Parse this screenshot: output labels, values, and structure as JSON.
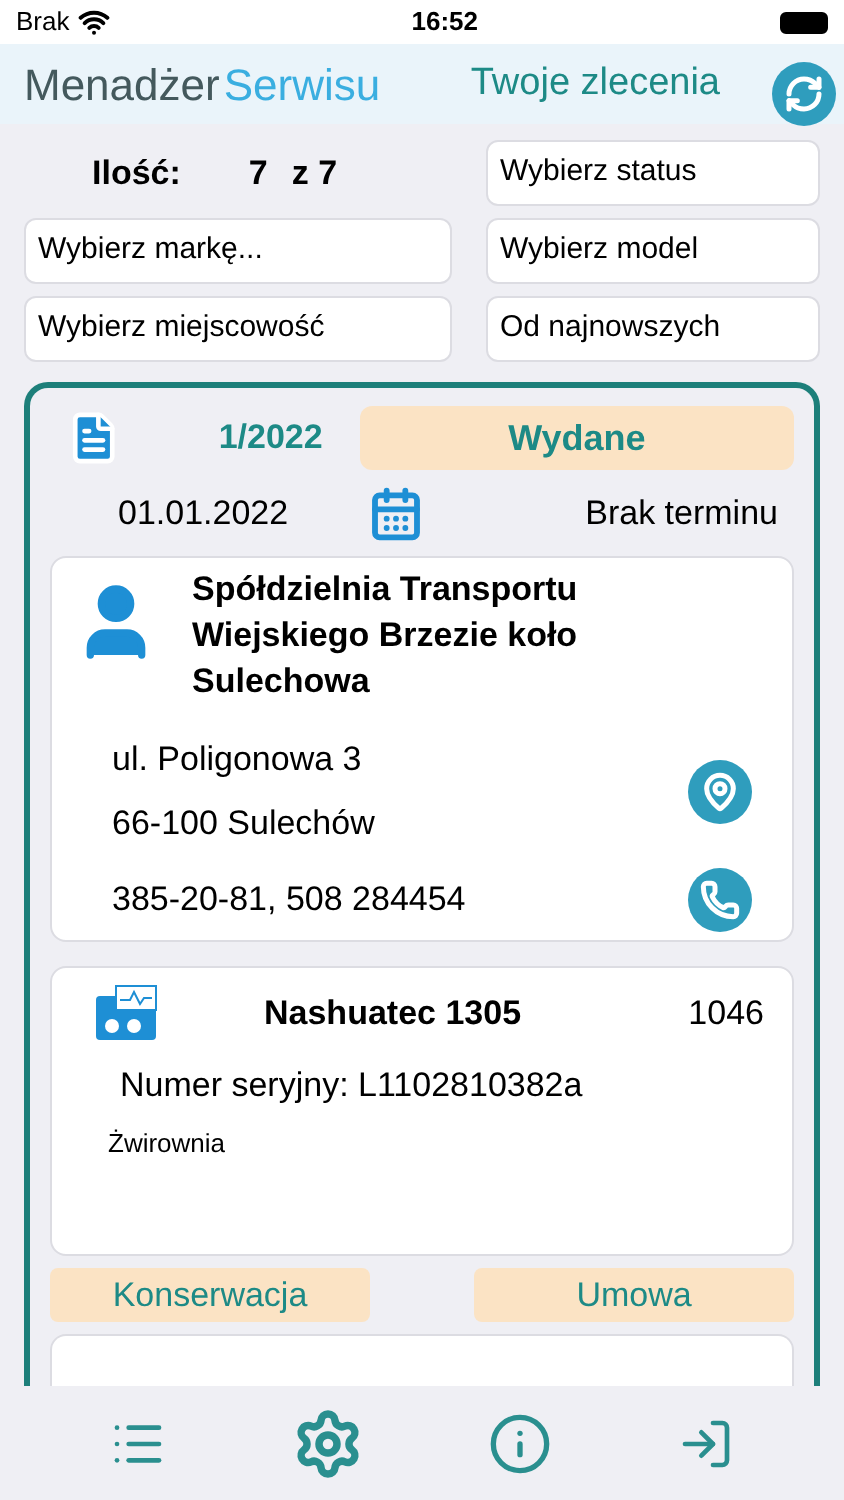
{
  "status_bar": {
    "carrier": "Brak",
    "time": "16:52"
  },
  "header": {
    "logo_part1": "Menadżer",
    "logo_part2": "Serwisu",
    "title": "Twoje zlecenia"
  },
  "filters": {
    "count_label": "Ilość:",
    "count": "7",
    "count_total": "z 7",
    "fields": [
      {
        "value": "Wybierz status"
      },
      {
        "value": "Wybierz markę..."
      },
      {
        "value": "Wybierz model"
      },
      {
        "value": "Wybierz miejscowość"
      },
      {
        "value": "Od najnowszych"
      }
    ]
  },
  "order": {
    "number": "1/2022",
    "status": "Wydane",
    "date": "01.01.2022",
    "deadline": "Brak terminu",
    "client": {
      "name": "Spółdzielnia Transportu Wiejskiego Brzezie koło Sulechowa",
      "street": "ul. Poligonowa 3",
      "city": "66-100 Sulechów",
      "phones": "385-20-81, 508 284454"
    },
    "device": {
      "model": "Nashuatec 1305",
      "code": "1046",
      "serial": "Numer seryjny: L1102810382a",
      "location": "Żwirownia"
    },
    "tags": [
      "Konserwacja",
      "Umowa"
    ]
  },
  "tab_bar": [
    {
      "kind": "list"
    },
    {
      "kind": "settings"
    },
    {
      "kind": "info"
    },
    {
      "kind": "logout"
    }
  ]
}
